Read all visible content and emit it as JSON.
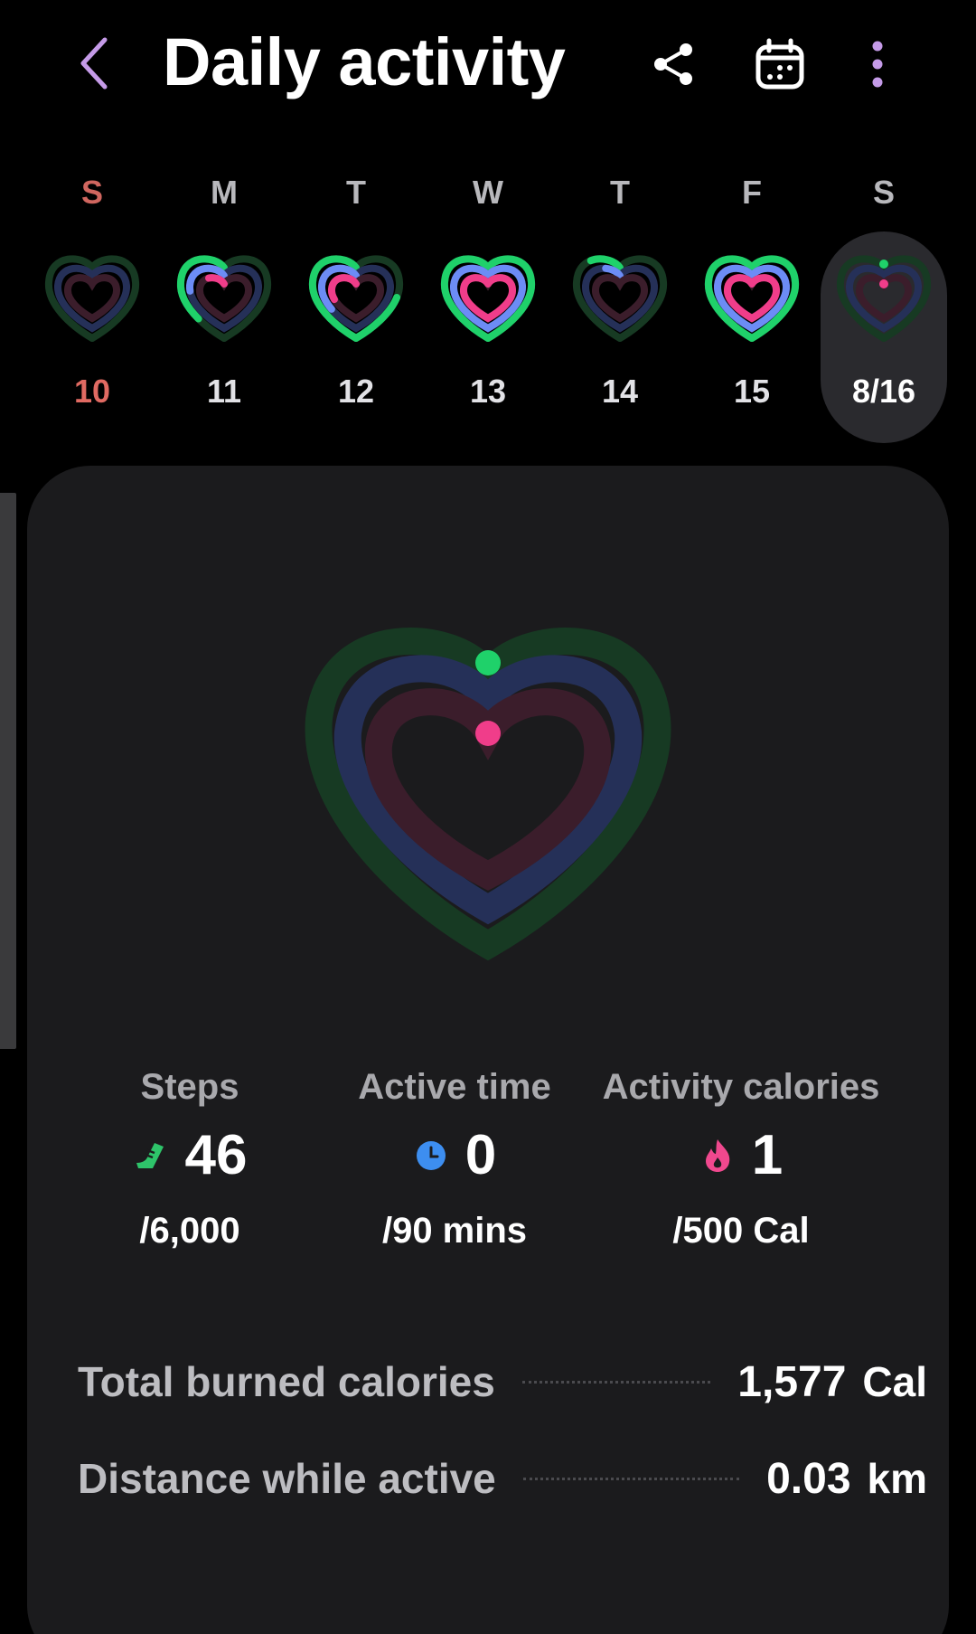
{
  "header": {
    "title": "Daily activity",
    "back_icon": "back-chevron-icon",
    "share_icon": "share-icon",
    "calendar_icon": "calendar-icon",
    "more_icon": "more-vertical-icon"
  },
  "week": {
    "days": [
      {
        "letter": "S",
        "number": "10",
        "steps_progress": 0.0,
        "active_progress": 0.0,
        "calories_progress": 0.0
      },
      {
        "letter": "M",
        "number": "11",
        "steps_progress": 0.38,
        "active_progress": 0.25,
        "calories_progress": 0.12
      },
      {
        "letter": "T",
        "number": "12",
        "steps_progress": 0.72,
        "active_progress": 0.35,
        "calories_progress": 0.3
      },
      {
        "letter": "W",
        "number": "13",
        "steps_progress": 1.0,
        "active_progress": 1.0,
        "calories_progress": 1.0
      },
      {
        "letter": "T",
        "number": "14",
        "steps_progress": 0.12,
        "active_progress": 0.08,
        "calories_progress": 0.0
      },
      {
        "letter": "F",
        "number": "15",
        "steps_progress": 1.0,
        "active_progress": 1.0,
        "calories_progress": 1.0
      },
      {
        "letter": "S",
        "number": "8/16",
        "steps_progress": 0.0,
        "active_progress": 0.0,
        "calories_progress": 0.0
      }
    ],
    "selected_index": 6
  },
  "stats": {
    "steps": {
      "label": "Steps",
      "value": "46",
      "goal": "/6,000",
      "icon": "shoe-icon",
      "color": "#2ec46a"
    },
    "active_time": {
      "label": "Active time",
      "value": "0",
      "goal": "/90 mins",
      "icon": "clock-icon",
      "color": "#3d8ef0"
    },
    "calories": {
      "label": "Activity calories",
      "value": "1",
      "goal": "/500 Cal",
      "icon": "flame-icon",
      "color": "#f0488e"
    }
  },
  "summary": {
    "total_burned": {
      "label": "Total burned calories",
      "value": "1,577",
      "unit": "Cal"
    },
    "distance": {
      "label": "Distance while active",
      "value": "0.03",
      "unit": "km"
    }
  },
  "colors": {
    "steps_ring": "#1fd16a",
    "active_ring": "#6c8cf5",
    "calories_ring": "#f03d8a",
    "accent": "#c59be8"
  }
}
